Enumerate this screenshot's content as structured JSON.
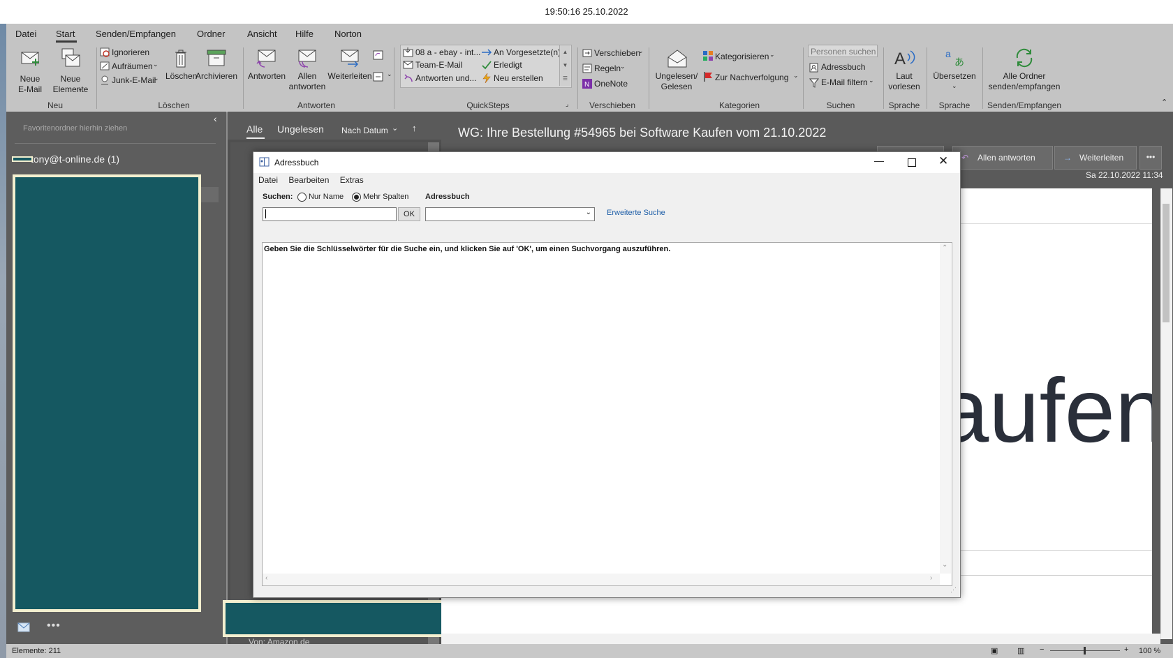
{
  "clock": "19:50:16 25.10.2022",
  "menu": [
    "Datei",
    "Start",
    "Senden/Empfangen",
    "Ordner",
    "Ansicht",
    "Hilfe",
    "Norton"
  ],
  "ribbon": {
    "new_email": "Neue\nE-Mail",
    "new_items": "Neue\nElemente",
    "group_new": "Neu",
    "ignore": "Ignorieren",
    "cleanup": "Aufräumen",
    "junk": "Junk-E-Mail",
    "delete": "Löschen",
    "archive": "Archivieren",
    "group_delete": "Löschen",
    "reply": "Antworten",
    "reply_all": "Allen\nantworten",
    "forward": "Weiterleiten",
    "group_respond": "Antworten",
    "qs1": "08 a - ebay - int...",
    "qs2": "Team-E-Mail",
    "qs3": "Antworten und...",
    "qs4": "An Vorgesetzte(n)",
    "qs5": "Erledigt",
    "qs6": "Neu erstellen",
    "group_quicksteps": "QuickSteps",
    "move": "Verschieben",
    "rules": "Regeln",
    "onenote": "OneNote",
    "group_move": "Verschieben",
    "unread_read": "Ungelesen/\nGelesen",
    "categorize": "Kategorisieren",
    "followup": "Zur Nachverfolgung",
    "group_tags": "Kategorien",
    "search_people": "Personen suchen",
    "addressbook": "Adressbuch",
    "filter_email": "E-Mail filtern",
    "group_find": "Suchen",
    "read_aloud": "Laut\nvorlesen",
    "group_speech": "Sprache",
    "translate": "Übersetzen",
    "group_language": "Sprache",
    "send_all": "Alle Ordner\nsenden/empfangen",
    "group_sendreceive": "Senden/Empfangen"
  },
  "nav": {
    "favorites_hint": "Favoritenordner hierhin ziehen",
    "account": "tony@t-online.de (1)"
  },
  "list": {
    "tab_all": "Alle",
    "tab_unread": "Ungelesen",
    "sort": "Nach Datum",
    "bottom_from": "Von: Amazon.de"
  },
  "reading": {
    "subject": "WG: Ihre Bestellung #54965 bei Software Kaufen vom 21.10.2022",
    "reply_all": "Allen antworten",
    "forward": "Weiterleiten",
    "date": "Sa 22.10.2022 11:34",
    "logo_text": "aufen"
  },
  "status": {
    "items": "Elemente: 211",
    "zoom": "100 %"
  },
  "dialog": {
    "title": "Adressbuch",
    "menu": [
      "Datei",
      "Bearbeiten",
      "Extras"
    ],
    "search_label": "Suchen:",
    "radio_name": "Nur Name",
    "radio_more": "Mehr Spalten",
    "addressbook_label": "Adressbuch",
    "ok": "OK",
    "advanced": "Erweiterte Suche",
    "hint": "Geben Sie die Schlüsselwörter für die Suche ein, und klicken Sie auf 'OK', um einen Suchvorgang auszuführen."
  }
}
